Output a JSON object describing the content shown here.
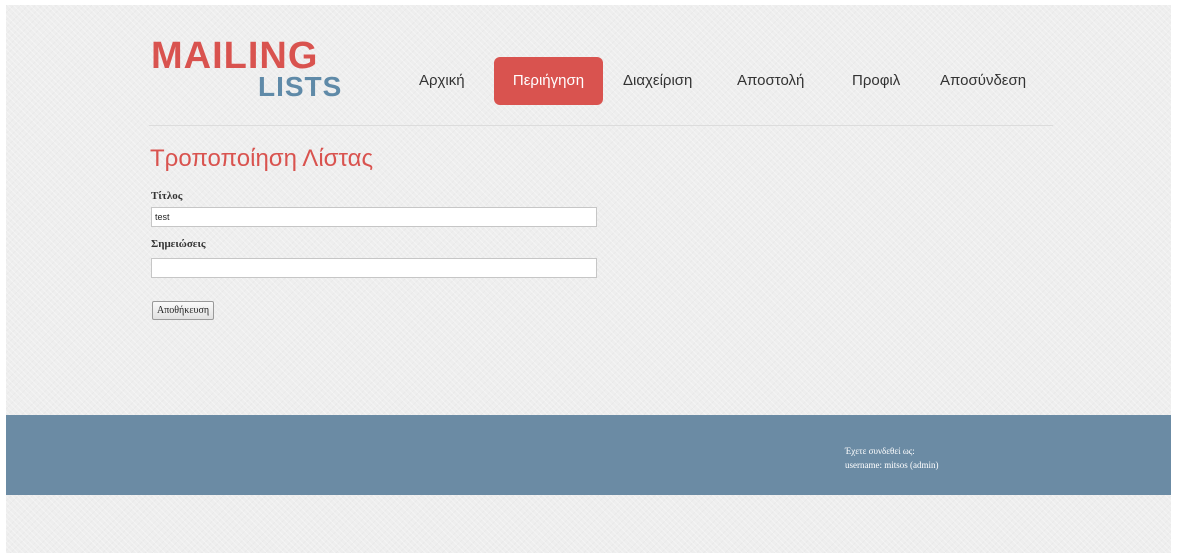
{
  "logo": {
    "top": "MAILING",
    "bottom": "LISTS"
  },
  "nav": {
    "items": [
      {
        "label": "Αρχική",
        "active": false
      },
      {
        "label": "Περιήγηση",
        "active": true
      },
      {
        "label": "Διαχείριση",
        "active": false
      },
      {
        "label": "Αποστολή",
        "active": false
      },
      {
        "label": "Προφιλ",
        "active": false
      },
      {
        "label": "Αποσύνδεση",
        "active": false
      }
    ]
  },
  "form": {
    "title": "Τροποποίηση Λίστας",
    "title_field_label": "Τίτλος",
    "title_field_value": "test",
    "notes_field_label": "Σημειώσεις",
    "notes_field_value": "",
    "save_label": "Αποθήκευση"
  },
  "footer": {
    "line1": "Έχετε συνδεθεί ως:",
    "line2": "username: mitsos (admin)"
  },
  "colors": {
    "accent": "#d9534f",
    "logo_secondary": "#5f8aa8",
    "footer_bg": "#6b8ba4",
    "page_bg": "#eeeeee"
  }
}
